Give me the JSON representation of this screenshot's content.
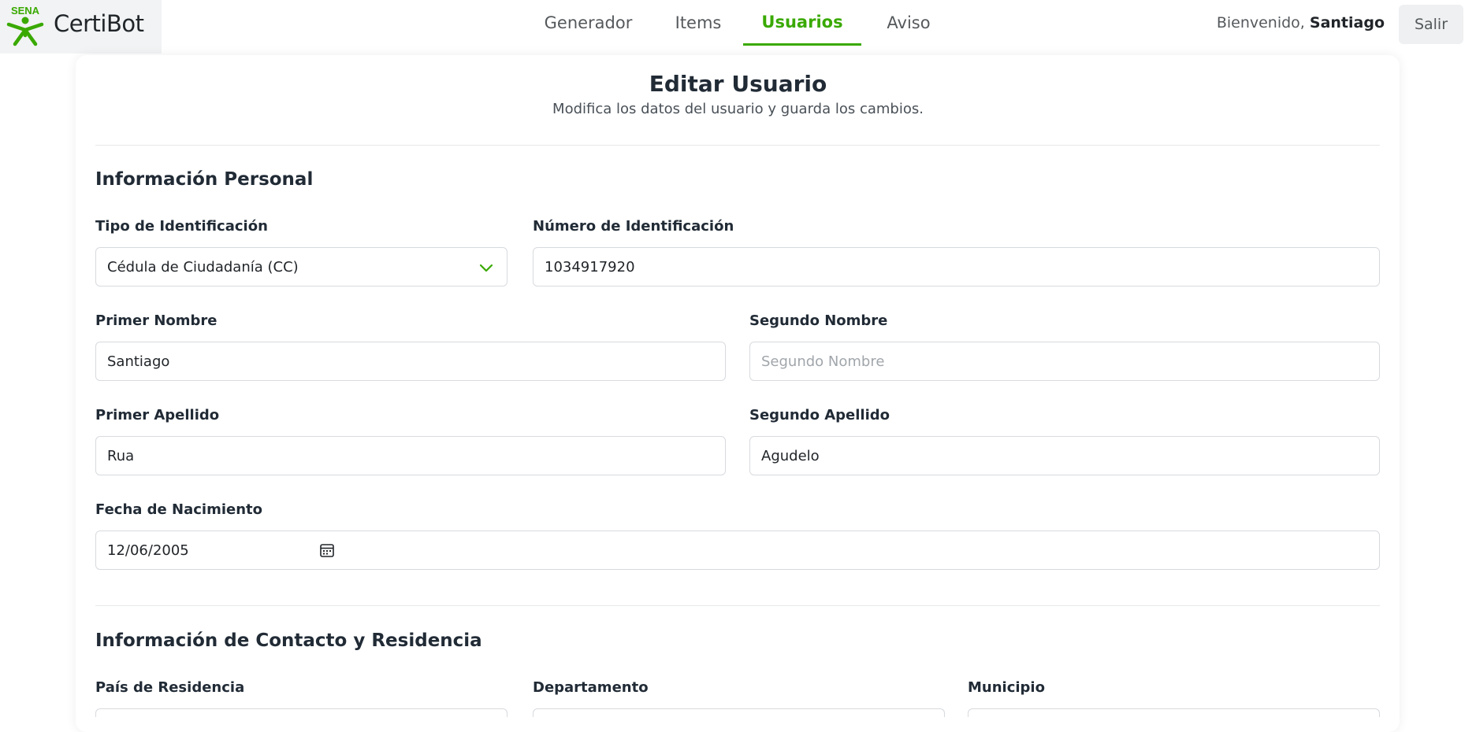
{
  "brand": {
    "logo_text": "SENA",
    "name": "CertiBot"
  },
  "nav": {
    "items": [
      {
        "label": "Generador",
        "active": false
      },
      {
        "label": "Items",
        "active": false
      },
      {
        "label": "Usuarios",
        "active": true
      },
      {
        "label": "Aviso",
        "active": false
      }
    ]
  },
  "user": {
    "welcome_prefix": "Bienvenido,",
    "name": "Santiago",
    "logout_label": "Salir"
  },
  "page": {
    "title": "Editar Usuario",
    "subtitle": "Modifica los datos del usuario y guarda los cambios."
  },
  "personal": {
    "section_title": "Información Personal",
    "id_type": {
      "label": "Tipo de Identificación",
      "value": "Cédula de Ciudadanía (CC)"
    },
    "id_number": {
      "label": "Número de Identificación",
      "value": "1034917920"
    },
    "first_name": {
      "label": "Primer Nombre",
      "value": "Santiago"
    },
    "second_name": {
      "label": "Segundo Nombre",
      "value": "",
      "placeholder": "Segundo Nombre"
    },
    "first_surname": {
      "label": "Primer Apellido",
      "value": "Rua"
    },
    "second_surname": {
      "label": "Segundo Apellido",
      "value": "Agudelo"
    },
    "birth_date": {
      "label": "Fecha de Nacimiento",
      "value": "12/06/2005"
    }
  },
  "contact": {
    "section_title": "Información de Contacto y Residencia",
    "country": {
      "label": "País de Residencia"
    },
    "department": {
      "label": "Departamento"
    },
    "municipality": {
      "label": "Municipio"
    }
  },
  "colors": {
    "accent": "#39a900",
    "text": "#212b36",
    "border": "#d7dade"
  },
  "icons": {
    "dropdown": "chevron-down-icon",
    "date": "calendar-icon"
  }
}
